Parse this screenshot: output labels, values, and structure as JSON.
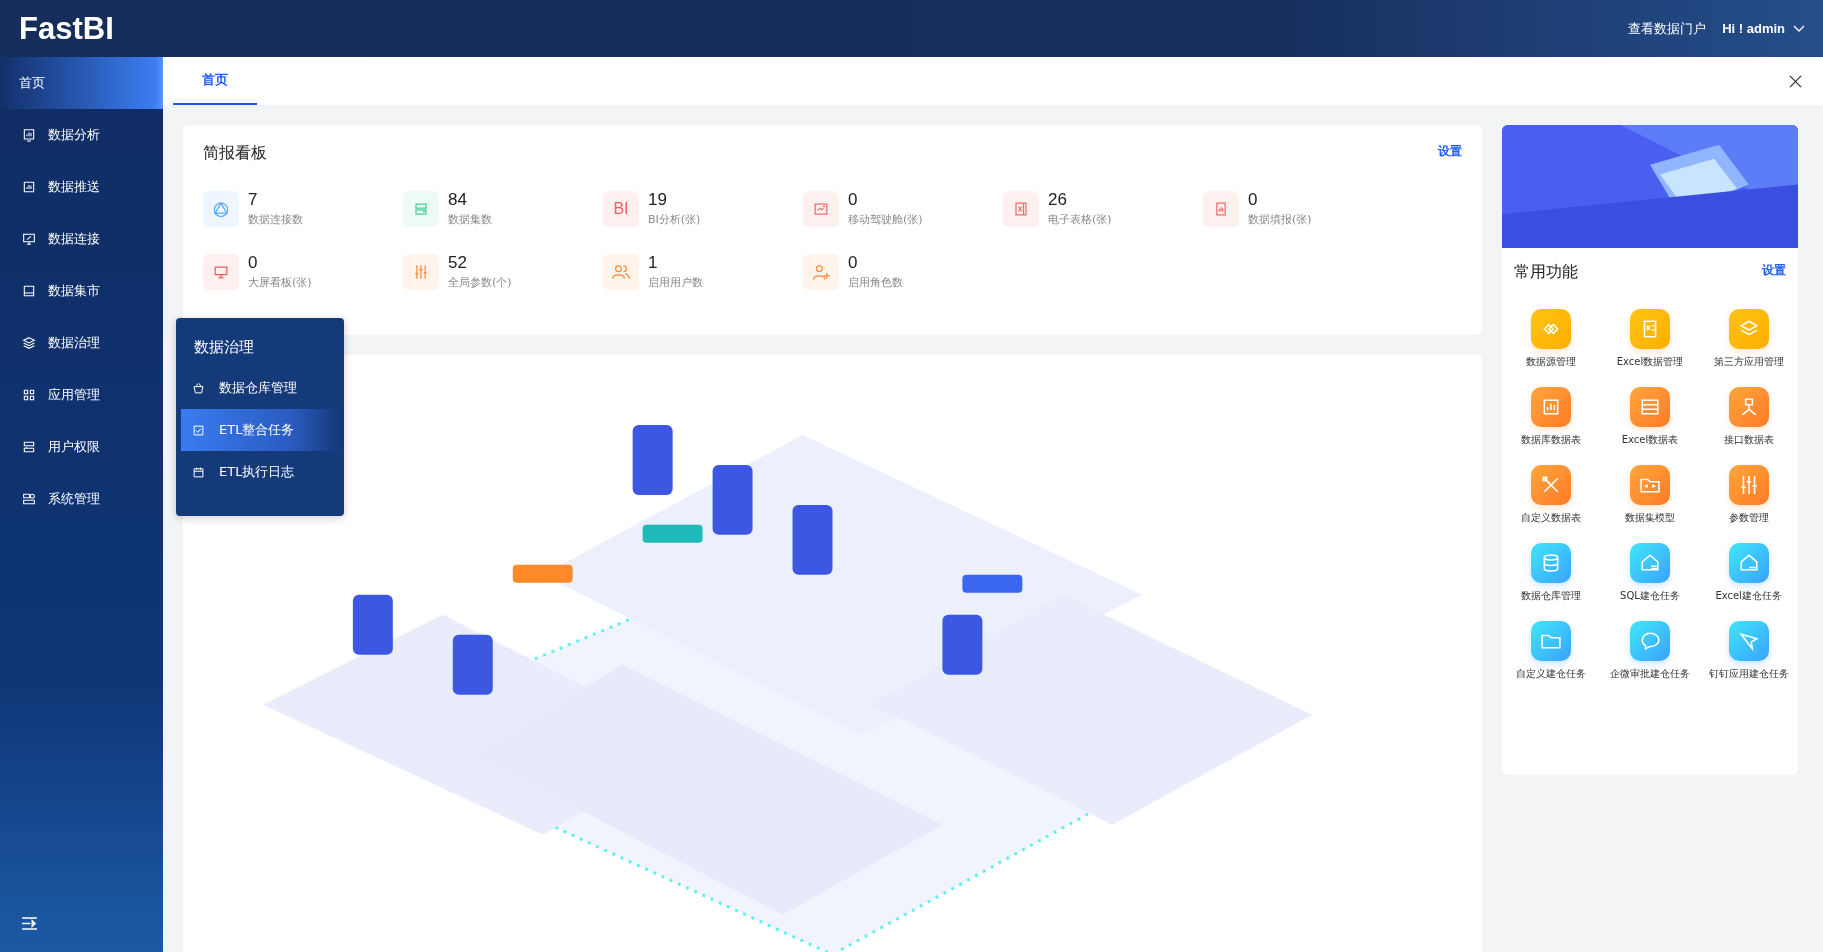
{
  "header": {
    "logo": "FastBI",
    "portal_link": "查看数据门户",
    "user": "Hi ! admin"
  },
  "sidebar": {
    "items": [
      {
        "label": "首页",
        "selected": true
      },
      {
        "label": "数据分析",
        "selected": false
      },
      {
        "label": "数据推送",
        "selected": false
      },
      {
        "label": "数据连接",
        "selected": false
      },
      {
        "label": "数据集市",
        "selected": false
      },
      {
        "label": "数据治理",
        "selected": false
      },
      {
        "label": "应用管理",
        "selected": false
      },
      {
        "label": "用户权限",
        "selected": false
      },
      {
        "label": "系统管理",
        "selected": false
      }
    ]
  },
  "flyout": {
    "title": "数据治理",
    "items": [
      {
        "label": "数据仓库管理",
        "selected": false
      },
      {
        "label": "ETL整合任务",
        "selected": true
      },
      {
        "label": "ETL执行日志",
        "selected": false
      }
    ]
  },
  "tabs": [
    {
      "label": "首页",
      "selected": true
    }
  ],
  "summary": {
    "title": "简报看板",
    "settings": "设置",
    "stats": [
      {
        "value": "7",
        "label": "数据连接数"
      },
      {
        "value": "84",
        "label": "数据集数"
      },
      {
        "value": "19",
        "label": "BI分析(张)",
        "icon_text": "BI"
      },
      {
        "value": "0",
        "label": "移动驾驶舱(张)"
      },
      {
        "value": "26",
        "label": "电子表格(张)"
      },
      {
        "value": "0",
        "label": "数据填报(张)"
      },
      {
        "value": "0",
        "label": "大屏看板(张)"
      },
      {
        "value": "52",
        "label": "全局参数(个)"
      },
      {
        "value": "1",
        "label": "启用用户数"
      },
      {
        "value": "0",
        "label": "启用角色数"
      }
    ]
  },
  "shortcuts": {
    "title": "常用功能",
    "settings": "设置",
    "items": [
      "数据源管理",
      "Excel数据管理",
      "第三方应用管理",
      "数据库数据表",
      "Excel数据表",
      "接口数据表",
      "自定义数据表",
      "数据集模型",
      "参数管理",
      "数据仓库管理",
      "SQL建仓任务",
      "Excel建仓任务",
      "自定义建仓任务",
      "企微审批建仓任务",
      "钉钉应用建仓任务"
    ]
  }
}
